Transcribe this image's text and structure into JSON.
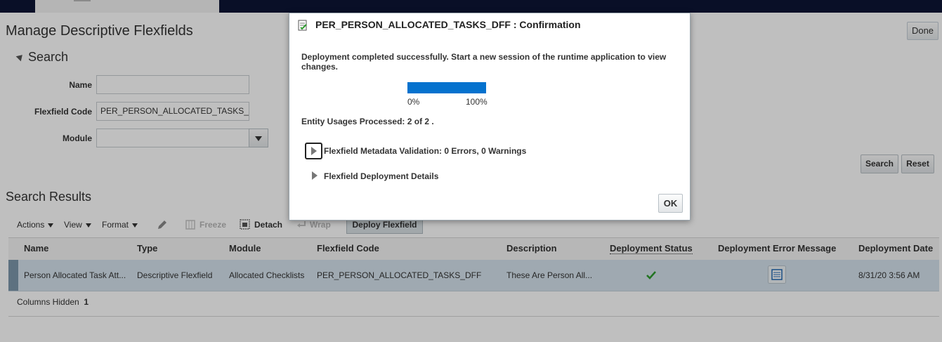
{
  "page": {
    "title": "Manage Descriptive Flexfields",
    "done_label": "Done"
  },
  "search": {
    "heading": "Search",
    "name_label": "Name",
    "name_value": "",
    "code_label": "Flexfield Code",
    "code_value": "PER_PERSON_ALLOCATED_TASKS_",
    "module_label": "Module",
    "module_value": "",
    "search_button": "Search",
    "reset_button": "Reset"
  },
  "results": {
    "heading": "Search Results",
    "toolbar": {
      "actions": "Actions",
      "view": "View",
      "format": "Format",
      "freeze": "Freeze",
      "detach": "Detach",
      "wrap": "Wrap",
      "deploy": "Deploy Flexfield"
    },
    "columns": [
      "Name",
      "Type",
      "Module",
      "Flexfield Code",
      "Description",
      "Deployment Status",
      "Deployment Error Message",
      "Deployment Date"
    ],
    "rows": [
      {
        "name": "Person Allocated Task Att...",
        "type": "Descriptive Flexfield",
        "module": "Allocated Checklists",
        "code": "PER_PERSON_ALLOCATED_TASKS_DFF",
        "description": "These Are Person All...",
        "date": "8/31/20 3:56 AM"
      }
    ],
    "columns_hidden_label": "Columns Hidden",
    "columns_hidden_count": "1"
  },
  "dialog": {
    "title": "PER_PERSON_ALLOCATED_TASKS_DFF : Confirmation",
    "message": "Deployment completed successfully. Start a new session of the runtime application to view changes.",
    "progress": 1.0,
    "progress_min_label": "0%",
    "progress_max_label": "100%",
    "entity_label": "Entity Usages Processed:",
    "entity_value": "2 of 2 .",
    "validation_label": "Flexfield Metadata Validation: 0 Errors, 0 Warnings",
    "details_label": "Flexfield Deployment Details",
    "ok_label": "OK"
  },
  "colors": {
    "header_bar": "#0d1435",
    "progress": "#0572ce",
    "selected_row": "#d5e2ec",
    "status_ok": "#2e9b2e"
  },
  "icons": {
    "status": "check-icon",
    "error_message": "details-icon",
    "dialog": "confirmation-icon"
  }
}
